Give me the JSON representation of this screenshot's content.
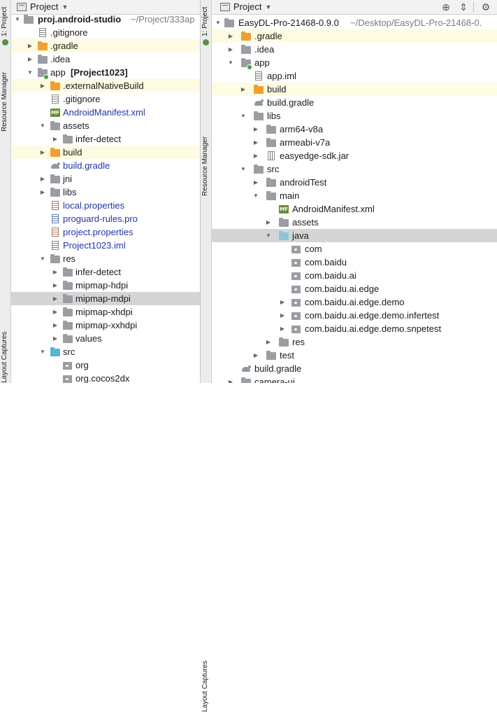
{
  "left_sidebar": {
    "tabs": [
      {
        "label": "1: Project"
      },
      {
        "label": "Resource Manager"
      },
      {
        "label": "Layout Captures"
      }
    ]
  },
  "right_sidebar": {
    "tabs": [
      {
        "label": "1: Project"
      },
      {
        "label": "Resource Manager"
      },
      {
        "label": "Layout Captures"
      }
    ]
  },
  "left_panel": {
    "header": {
      "title": "Project"
    },
    "rows": [
      {
        "name": "proj.android-studio",
        "path": " ~/Project/333ap",
        "bold": true
      },
      {
        "name": ".gitignore"
      },
      {
        "name": ".gradle"
      },
      {
        "name": ".idea"
      },
      {
        "name": "app",
        "suffix": "[Project1023]"
      },
      {
        "name": ".externalNativeBuild"
      },
      {
        "name": ".gitignore"
      },
      {
        "name": "AndroidManifest.xml"
      },
      {
        "name": "assets"
      },
      {
        "name": "infer-detect"
      },
      {
        "name": "build"
      },
      {
        "name": "build.gradle"
      },
      {
        "name": "jni"
      },
      {
        "name": "libs"
      },
      {
        "name": "local.properties"
      },
      {
        "name": "proguard-rules.pro"
      },
      {
        "name": "project.properties"
      },
      {
        "name": "Project1023.iml"
      },
      {
        "name": "res"
      },
      {
        "name": "infer-detect"
      },
      {
        "name": "mipmap-hdpi"
      },
      {
        "name": "mipmap-mdpi"
      },
      {
        "name": "mipmap-xhdpi"
      },
      {
        "name": "mipmap-xxhdpi"
      },
      {
        "name": "values"
      },
      {
        "name": "src"
      },
      {
        "name": "org"
      },
      {
        "name": "org.cocos2dx"
      }
    ]
  },
  "right_panel": {
    "header": {
      "title": "Project"
    },
    "rows": [
      {
        "name": "EasyDL-Pro-21468-0.9.0",
        "path": "  ~/Desktop/EasyDL-Pro-21468-0."
      },
      {
        "name": ".gradle"
      },
      {
        "name": ".idea"
      },
      {
        "name": "app"
      },
      {
        "name": "app.iml"
      },
      {
        "name": "build"
      },
      {
        "name": "build.gradle"
      },
      {
        "name": "libs"
      },
      {
        "name": "arm64-v8a"
      },
      {
        "name": "armeabi-v7a"
      },
      {
        "name": "easyedge-sdk.jar"
      },
      {
        "name": "src"
      },
      {
        "name": "androidTest"
      },
      {
        "name": "main"
      },
      {
        "name": "AndroidManifest.xml"
      },
      {
        "name": "assets"
      },
      {
        "name": "java"
      },
      {
        "name": "com"
      },
      {
        "name": "com.baidu"
      },
      {
        "name": "com.baidu.ai"
      },
      {
        "name": "com.baidu.ai.edge"
      },
      {
        "name": "com.baidu.ai.edge.demo"
      },
      {
        "name": "com.baidu.ai.edge.demo.infertest"
      },
      {
        "name": "com.baidu.ai.edge.demo.snpetest"
      },
      {
        "name": "res"
      },
      {
        "name": "test"
      },
      {
        "name": "build.gradle"
      },
      {
        "name": "camera-ui"
      }
    ]
  },
  "icons": {
    "target": "crosshair-icon",
    "collapse": "collapse-all-icon",
    "settings": "gear-icon"
  },
  "colors": {
    "highlight_yellow": "#fdfbe2",
    "selection_gray": "#d5d5d5",
    "link_blue": "#2235a5",
    "folder_orange": "#f0a030",
    "folder_blue": "#58b3d9"
  }
}
